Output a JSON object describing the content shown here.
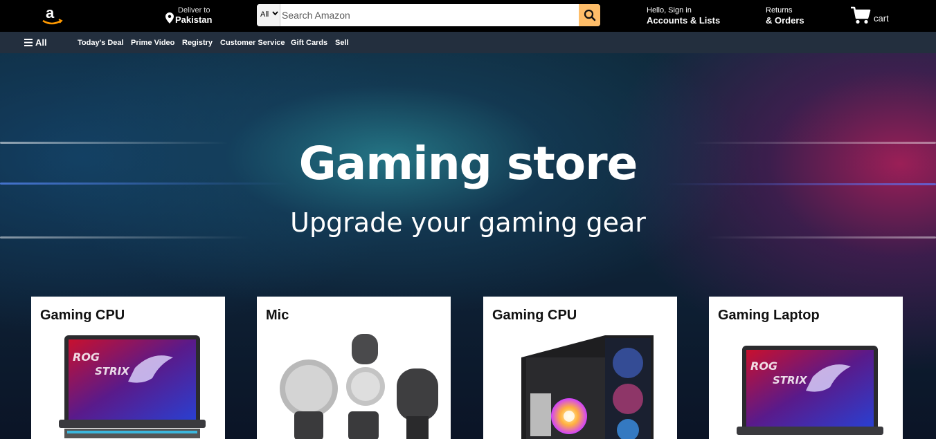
{
  "header": {
    "deliver_small": "Deliver to",
    "deliver_country": "Pakistan",
    "search_category": "All",
    "search_placeholder": "Search Amazon",
    "account_small": "Hello, Sign in",
    "account_big": "Accounts & Lists",
    "returns_small": "Returns",
    "returns_big": "& Orders",
    "cart_label": "cart"
  },
  "subnav": {
    "all_label": "All",
    "links": [
      "Today's Deal",
      "Prime Video",
      "Registry",
      "Customer Service",
      "Gift Cards",
      "Sell"
    ]
  },
  "hero": {
    "title": "Gaming store",
    "subtitle": "Upgrade your gaming gear"
  },
  "cards": [
    {
      "title": "Gaming CPU",
      "image": "gaming-laptop-image"
    },
    {
      "title": "Mic",
      "image": "microphone-windscreen-image"
    },
    {
      "title": "Gaming CPU",
      "image": "gaming-pc-case-image"
    },
    {
      "title": "Gaming Laptop",
      "image": "gaming-laptop-image"
    }
  ],
  "colors": {
    "topbar": "#000000",
    "subnav": "#232f3e",
    "search_button": "#febd69",
    "logo_accent": "#ff9900"
  }
}
